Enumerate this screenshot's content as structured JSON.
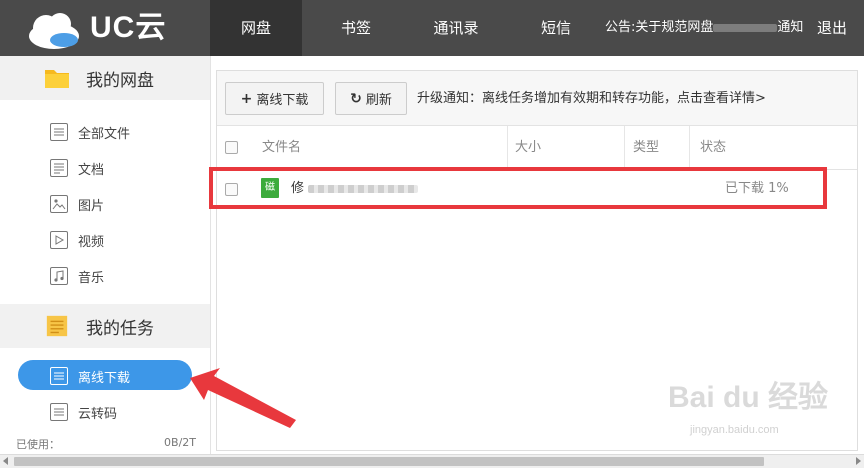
{
  "app": {
    "logo_text": "UC云",
    "brand_color": "#4a4a4a",
    "accent_color": "#3d97e8",
    "highlight_color": "#e8383d"
  },
  "nav": {
    "tabs": [
      {
        "label": "网盘",
        "active": true
      },
      {
        "label": "书签",
        "active": false
      },
      {
        "label": "通讯录",
        "active": false
      },
      {
        "label": "短信",
        "active": false
      }
    ],
    "announcement_prefix": "公告:关于规范网盘",
    "announcement_suffix": "通知",
    "logout_label": "退出"
  },
  "sidebar": {
    "disk_title": "我的网盘",
    "disk_items": [
      {
        "label": "全部文件",
        "icon": "list-icon"
      },
      {
        "label": "文档",
        "icon": "document-icon"
      },
      {
        "label": "图片",
        "icon": "image-icon"
      },
      {
        "label": "视频",
        "icon": "video-icon"
      },
      {
        "label": "音乐",
        "icon": "music-icon"
      }
    ],
    "task_title": "我的任务",
    "task_items": [
      {
        "label": "离线下载",
        "icon": "list-icon",
        "active": true
      },
      {
        "label": "云转码",
        "icon": "list-icon",
        "active": false
      }
    ],
    "usage_label": "已使用：",
    "usage_value": "0B/2T"
  },
  "toolbar": {
    "offline_download_label": "离线下载",
    "refresh_label": "刷新",
    "notice": "升级通知：离线任务增加有效期和转存功能，点击查看详情>"
  },
  "table": {
    "columns": [
      "文件名",
      "大小",
      "类型",
      "状态"
    ],
    "rows": [
      {
        "icon_text": "磁",
        "name_prefix": "修",
        "size": "",
        "type": "",
        "status": "已下载 1%",
        "progress": 0.01
      }
    ]
  },
  "watermark": {
    "text": "Bai du 经验",
    "sub": "jingyan.baidu.com"
  }
}
